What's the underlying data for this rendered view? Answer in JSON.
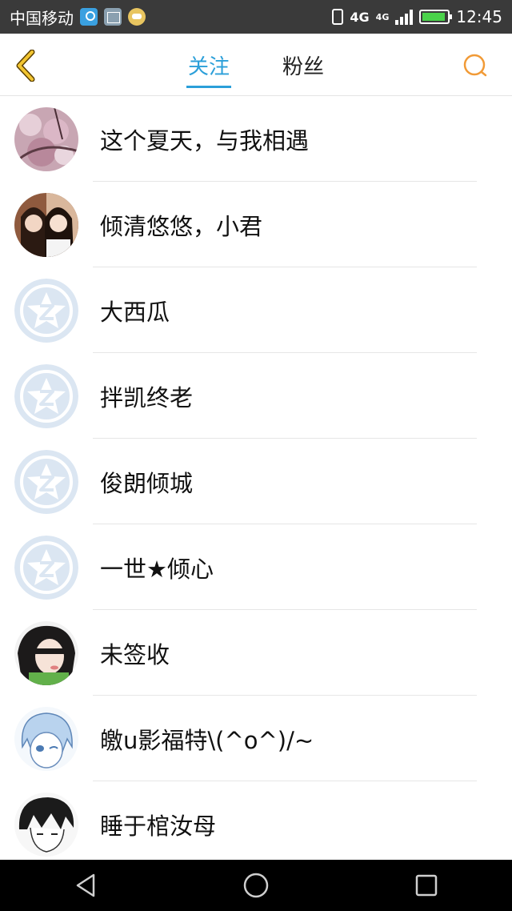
{
  "status_bar": {
    "carrier": "中国移动",
    "network": "4G",
    "network_small": "4G",
    "time": "12:45",
    "icons": [
      "location-icon",
      "gallery-icon",
      "chat-icon",
      "vibrate-icon",
      "signal-icon",
      "battery-icon"
    ]
  },
  "header": {
    "tabs": [
      {
        "label": "关注",
        "active": true
      },
      {
        "label": "粉丝",
        "active": false
      }
    ],
    "accent_color": "#2b9fd9",
    "back_icon": "chevron-left-icon",
    "search_icon": "search-icon"
  },
  "list": {
    "items": [
      {
        "name": "这个夏天，与我相遇",
        "avatar": "photo-blossom"
      },
      {
        "name": "倾清悠悠，小君",
        "avatar": "photo-two-girls"
      },
      {
        "name": "大西瓜",
        "avatar": "default-star"
      },
      {
        "name": "拌凯终老",
        "avatar": "default-star"
      },
      {
        "name": "俊朗倾城",
        "avatar": "default-star"
      },
      {
        "name": "一世★倾心",
        "avatar": "default-star"
      },
      {
        "name": "未签收",
        "avatar": "photo-girl"
      },
      {
        "name": "皦u影福特\\(^o^)/~",
        "avatar": "anime-blue"
      },
      {
        "name": "睡于棺汝母",
        "avatar": "anime-sketch"
      }
    ]
  },
  "nav_bar": {
    "buttons": [
      "back-triangle-icon",
      "home-circle-icon",
      "recents-square-icon"
    ]
  }
}
